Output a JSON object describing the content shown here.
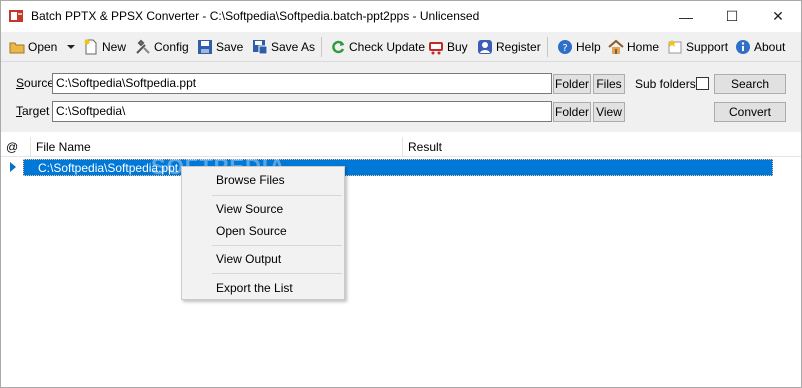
{
  "window": {
    "title": "Batch PPTX & PPSX Converter - C:\\Softpedia\\Softpedia.batch-ppt2pps - Unlicensed",
    "minimize": "—",
    "maximize": "☐",
    "close": "✕"
  },
  "toolbar": {
    "open": "Open",
    "new": "New",
    "config": "Config",
    "save": "Save",
    "save_as": "Save As",
    "check_update": "Check Update",
    "buy": "Buy",
    "register": "Register",
    "help": "Help",
    "home": "Home",
    "support": "Support",
    "about": "About"
  },
  "form": {
    "source_label_u": "S",
    "source_label_rest": "ource",
    "source_value": "C:\\Softpedia\\Softpedia.ppt",
    "target_label_u": "T",
    "target_label_rest": "arget",
    "target_value": "C:\\Softpedia\\",
    "folder_btn": "Folder",
    "files_btn": "Files",
    "view_btn": "View",
    "subfolders_label": "Sub folders",
    "search_btn": "Search",
    "convert_btn": "Convert"
  },
  "list": {
    "columns": [
      "@",
      "File Name",
      "Result"
    ],
    "rows": [
      {
        "file": "C:\\Softpedia\\Softpedia.ppt",
        "result": ""
      }
    ],
    "watermark": "SOFTPEDIA"
  },
  "context_menu": {
    "items": [
      "Browse Files",
      "View  Source",
      "Open Source",
      "View  Output",
      "Export the List"
    ]
  },
  "colors": {
    "selection": "#0078d7",
    "toolbar_bg": "#f0f0f0"
  }
}
